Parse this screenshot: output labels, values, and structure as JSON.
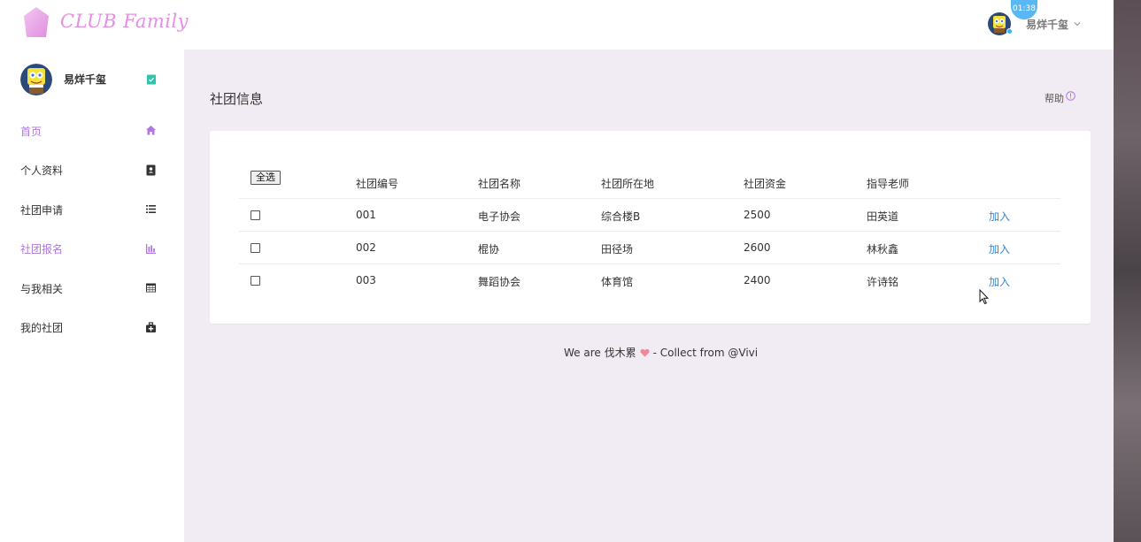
{
  "header": {
    "brand": "CLUB Family",
    "user_name": "易烊千玺",
    "time_badge": "01:38",
    "colors": {
      "brand": "#e58fe3",
      "accent": "#b077e0",
      "link": "#3b86d6",
      "badge": "#59b7f3"
    }
  },
  "sidebar": {
    "profile_name": "易烊千玺",
    "items": [
      {
        "label": "首页",
        "icon": "home-icon",
        "active": true
      },
      {
        "label": "个人资料",
        "icon": "id-card-icon",
        "active": false
      },
      {
        "label": "社团申请",
        "icon": "list-icon",
        "active": false
      },
      {
        "label": "社团报名",
        "icon": "bar-chart-icon",
        "active": true
      },
      {
        "label": "与我相关",
        "icon": "table-icon",
        "active": false
      },
      {
        "label": "我的社团",
        "icon": "medkit-icon",
        "active": false
      }
    ]
  },
  "main": {
    "title": "社团信息",
    "help_label": "帮助"
  },
  "table": {
    "select_all_label": "全选",
    "headers": [
      "社团编号",
      "社团名称",
      "社团所在地",
      "社团资金",
      "指导老师"
    ],
    "rows": [
      {
        "id": "001",
        "name": "电子协会",
        "location": "综合楼B",
        "funds": "2500",
        "teacher": "田英道",
        "action": "加入"
      },
      {
        "id": "002",
        "name": "棍协",
        "location": "田径场",
        "funds": "2600",
        "teacher": "林秋鑫",
        "action": "加入"
      },
      {
        "id": "003",
        "name": "舞蹈协会",
        "location": "体育馆",
        "funds": "2400",
        "teacher": "许诗铭",
        "action": "加入"
      }
    ]
  },
  "footer": {
    "prefix": "We are 伐木累",
    "suffix": "- Collect from @Vivi"
  }
}
